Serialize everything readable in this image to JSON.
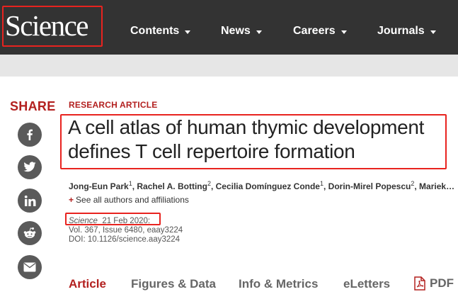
{
  "header": {
    "logo": "Science",
    "nav": [
      "Contents",
      "News",
      "Careers",
      "Journals"
    ]
  },
  "share": {
    "title": "SHARE",
    "buttons": [
      "facebook-icon",
      "twitter-icon",
      "linkedin-icon",
      "reddit-icon",
      "email-icon"
    ]
  },
  "article": {
    "type": "RESEARCH ARTICLE",
    "title": "A cell atlas of human thymic development defines T cell repertoire formation",
    "authors": [
      {
        "name": "Jong-Eun Park",
        "aff": "1"
      },
      {
        "name": "Rachel A. Botting",
        "aff": "2"
      },
      {
        "name": "Cecilia Domínguez Conde",
        "aff": "1"
      },
      {
        "name": "Dorin-Mirel Popescu",
        "aff": "2"
      },
      {
        "name": "Mariek…",
        "aff": ""
      }
    ],
    "see_all": "See all authors and affiliations",
    "journal": "Science",
    "date": "21 Feb 2020:",
    "volume": "Vol. 367, Issue 6480, eaay3224",
    "doi": "DOI: 10.1126/science.aay3224"
  },
  "tabs": [
    "Article",
    "Figures & Data",
    "Info & Metrics",
    "eLetters",
    "PDF"
  ],
  "colors": {
    "accent": "#b3201f",
    "highlight": "#e8231f",
    "header": "#333333"
  }
}
